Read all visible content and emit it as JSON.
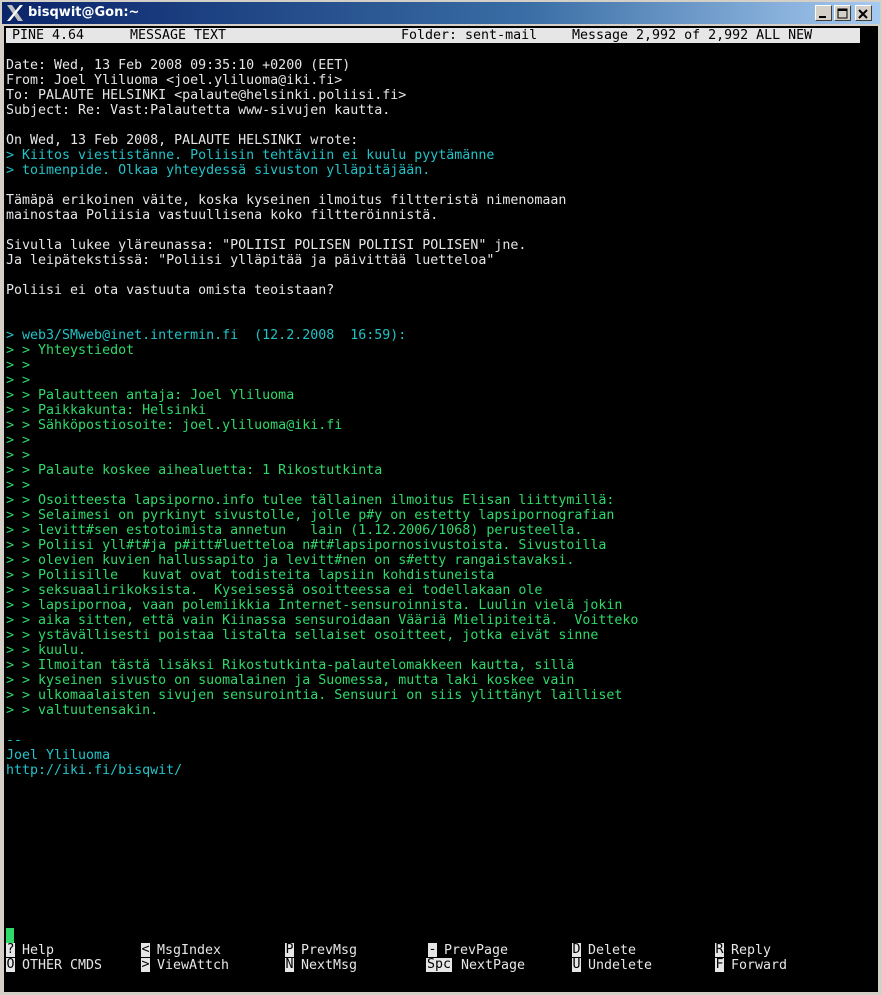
{
  "window": {
    "title": "bisqwit@Gon:~",
    "minimize_icon": "minimize-icon",
    "maximize_icon": "maximize-icon",
    "close_icon": "close-icon"
  },
  "header": {
    "app": "PINE 4.64",
    "mode": "MESSAGE TEXT",
    "folder": "Folder: sent-mail",
    "message": "Message 2,992 of 2,992 ALL NEW"
  },
  "message": {
    "date": "Date: Wed, 13 Feb 2008 09:35:10 +0200 (EET)",
    "from": "From: Joel Yliluoma <joel.yliluoma@iki.fi>",
    "to": "To: PALAUTE HELSINKI <palaute@helsinki.poliisi.fi>",
    "subject": "Subject: Re: Vast:Palautetta www-sivujen kautta.",
    "body": [
      {
        "text": "On Wed, 13 Feb 2008, PALAUTE HELSINKI wrote:",
        "color": "white"
      },
      {
        "text": "> Kiitos viestistänne. Poliisin tehtäviin ei kuulu pyytämänne",
        "color": "cyan"
      },
      {
        "text": "> toimenpide. Olkaa yhteydessä sivuston ylläpitäjään.",
        "color": "cyan"
      },
      {
        "text": "",
        "color": "white"
      },
      {
        "text": "Tämäpä erikoinen väite, koska kyseinen ilmoitus filtteristä nimenomaan",
        "color": "white"
      },
      {
        "text": "mainostaa Poliisia vastuullisena koko filtteröinnistä.",
        "color": "white"
      },
      {
        "text": "",
        "color": "white"
      },
      {
        "text": "Sivulla lukee yläreunassa: \"POLIISI POLISEN POLIISI POLISEN\" jne.",
        "color": "white"
      },
      {
        "text": "Ja leipätekstissä: \"Poliisi ylläpitää ja päivittää luetteloa\"",
        "color": "white"
      },
      {
        "text": "",
        "color": "white"
      },
      {
        "text": "Poliisi ei ota vastuuta omista teoistaan?",
        "color": "white"
      },
      {
        "text": "",
        "color": "white"
      },
      {
        "text": "",
        "color": "white"
      },
      {
        "text": "> web3/SMweb@inet.intermin.fi  (12.2.2008  16:59):",
        "color": "cyan"
      },
      {
        "text": "> > Yhteystiedot",
        "color": "green"
      },
      {
        "text": "> >",
        "color": "green"
      },
      {
        "text": "> >",
        "color": "green"
      },
      {
        "text": "> > Palautteen antaja: Joel Yliluoma",
        "color": "green"
      },
      {
        "text": "> > Paikkakunta: Helsinki",
        "color": "green"
      },
      {
        "text": "> > Sähköpostiosoite: joel.yliluoma@iki.fi",
        "color": "green"
      },
      {
        "text": "> >",
        "color": "green"
      },
      {
        "text": "> >",
        "color": "green"
      },
      {
        "text": "> > Palaute koskee aihealuetta: 1 Rikostutkinta",
        "color": "green"
      },
      {
        "text": "> >",
        "color": "green"
      },
      {
        "text": "> > Osoitteesta lapsiporno.info tulee tällainen ilmoitus Elisan liittymillä:",
        "color": "green"
      },
      {
        "text": "> > Selaimesi on pyrkinyt sivustolle, jolle p#y on estetty lapsipornografian",
        "color": "green"
      },
      {
        "text": "> > levitt#sen estotoimista annetun   lain (1.12.2006/1068) perusteella.",
        "color": "green"
      },
      {
        "text": "> > Poliisi yll#t#ja p#itt#luetteloa n#t#lapsipornosivustoista. Sivustoilla",
        "color": "green"
      },
      {
        "text": "> > olevien kuvien hallussapito ja levitt#nen on s#etty rangaistavaksi.",
        "color": "green"
      },
      {
        "text": "> > Poliisille   kuvat ovat todisteita lapsiin kohdistuneista",
        "color": "green"
      },
      {
        "text": "> > seksuaalirikoksista.  Kyseisessä osoitteessa ei todellakaan ole",
        "color": "green"
      },
      {
        "text": "> > lapsipornoa, vaan polemiikkia Internet-sensuroinnista. Luulin vielä jokin",
        "color": "green"
      },
      {
        "text": "> > aika sitten, että vain Kiinassa sensuroidaan Vääriä Mielipiteitä.  Voitteko",
        "color": "green"
      },
      {
        "text": "> > ystävällisesti poistaa listalta sellaiset osoitteet, jotka eivät sinne",
        "color": "green"
      },
      {
        "text": "> > kuulu.",
        "color": "green"
      },
      {
        "text": "> > Ilmoitan tästä lisäksi Rikostutkinta-palautelomakkeen kautta, sillä",
        "color": "green"
      },
      {
        "text": "> > kyseinen sivusto on suomalainen ja Suomessa, mutta laki koskee vain",
        "color": "green"
      },
      {
        "text": "> > ulkomaalaisten sivujen sensurointia. Sensuuri on siis ylittänyt lailliset",
        "color": "green"
      },
      {
        "text": "> > valtuutensakin.",
        "color": "green"
      },
      {
        "text": "",
        "color": "white"
      },
      {
        "text": "--",
        "color": "cyan"
      },
      {
        "text": "Joel Yliluoma",
        "color": "cyan"
      },
      {
        "text": "http://iki.fi/bisqwit/",
        "color": "cyan"
      }
    ]
  },
  "commands": [
    {
      "key": "?",
      "label": "Help"
    },
    {
      "key": "O",
      "label": "OTHER CMDS"
    },
    {
      "key": "<",
      "label": "MsgIndex"
    },
    {
      "key": ">",
      "label": "ViewAttch"
    },
    {
      "key": "P",
      "label": "PrevMsg"
    },
    {
      "key": "N",
      "label": "NextMsg"
    },
    {
      "key": "-",
      "label": "PrevPage"
    },
    {
      "key": "Spc",
      "label": "NextPage"
    },
    {
      "key": "D",
      "label": "Delete"
    },
    {
      "key": "U",
      "label": "Undelete"
    },
    {
      "key": "R",
      "label": "Reply"
    },
    {
      "key": "F",
      "label": "Forward"
    }
  ],
  "colors": {
    "cyan": "#22c3c8",
    "green": "#2fd96a",
    "white": "#e6e6e6",
    "background": "#000000"
  }
}
